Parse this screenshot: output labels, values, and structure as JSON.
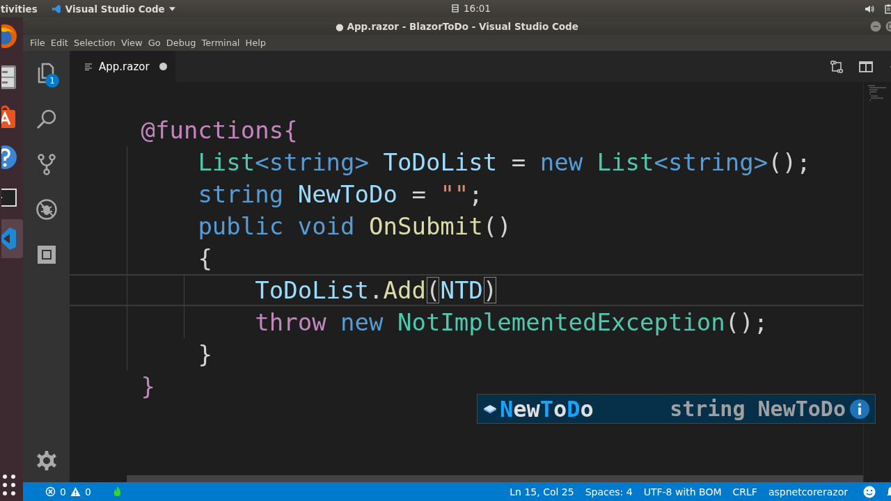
{
  "top_bar": {
    "activities": "tivities",
    "app_menu": "Visual Studio Code",
    "clock": "16:01"
  },
  "dock": [
    {
      "kind": "browser",
      "selected": false
    },
    {
      "kind": "files",
      "selected": false
    },
    {
      "kind": "software",
      "selected": false
    },
    {
      "kind": "help",
      "selected": false
    },
    {
      "kind": "terminal",
      "selected": false
    },
    {
      "kind": "editor",
      "selected": true
    },
    {
      "kind": "apps",
      "selected": false
    }
  ],
  "window": {
    "title": "● App.razor - BlazorToDo - Visual Studio Code"
  },
  "menu": [
    "File",
    "Edit",
    "Selection",
    "View",
    "Go",
    "Debug",
    "Terminal",
    "Help"
  ],
  "activity_bar": {
    "explorer_badge": "1"
  },
  "tabs": [
    {
      "label": "App.razor",
      "selected": true,
      "modified": true
    }
  ],
  "code_lines": [
    {
      "current": false,
      "tokens": [
        {
          "kind": "directive",
          "text": "@functions{"
        }
      ]
    },
    {
      "current": false,
      "tokens": [
        {
          "kind": "type",
          "text": "    List"
        },
        {
          "kind": "keyword",
          "text": "<string>"
        },
        {
          "kind": "variable",
          "text": " ToDoList"
        },
        {
          "kind": "plain",
          "text": " = "
        },
        {
          "kind": "keyword",
          "text": "new"
        },
        {
          "kind": "type",
          "text": " List"
        },
        {
          "kind": "keyword",
          "text": "<string>"
        },
        {
          "kind": "plain",
          "text": "();"
        }
      ]
    },
    {
      "current": false,
      "tokens": [
        {
          "kind": "keyword",
          "text": "    string"
        },
        {
          "kind": "variable",
          "text": " NewToDo"
        },
        {
          "kind": "plain",
          "text": " = "
        },
        {
          "kind": "string",
          "text": "\"\""
        },
        {
          "kind": "plain",
          "text": ";"
        }
      ]
    },
    {
      "current": false,
      "tokens": [
        {
          "kind": "keyword",
          "text": "    public void"
        },
        {
          "kind": "method",
          "text": " OnSubmit"
        },
        {
          "kind": "plain",
          "text": "()"
        }
      ]
    },
    {
      "current": false,
      "tokens": [
        {
          "kind": "plain",
          "text": "    {"
        }
      ]
    },
    {
      "current": true,
      "tokens": [
        {
          "kind": "variable",
          "text": "        ToDoList"
        },
        {
          "kind": "plain",
          "text": "."
        },
        {
          "kind": "method",
          "text": "Add"
        },
        {
          "kind": "bracket-match",
          "text": "("
        },
        {
          "kind": "variable",
          "text": "NTD"
        },
        {
          "kind": "bracket-match",
          "text": ")"
        }
      ]
    },
    {
      "current": false,
      "tokens": [
        {
          "kind": "control",
          "text": "        throw"
        },
        {
          "kind": "keyword",
          "text": " new"
        },
        {
          "kind": "type",
          "text": " NotImplementedException"
        },
        {
          "kind": "plain",
          "text": "();"
        }
      ]
    },
    {
      "current": false,
      "tokens": [
        {
          "kind": "plain",
          "text": "    }"
        }
      ]
    },
    {
      "current": false,
      "tokens": [
        {
          "kind": "directive",
          "text": "}"
        }
      ]
    }
  ],
  "suggestion": {
    "label": [
      {
        "text": "N",
        "match": true
      },
      {
        "text": "ew",
        "match": false
      },
      {
        "text": "T",
        "match": true
      },
      {
        "text": "o",
        "match": false
      },
      {
        "text": "D",
        "match": true
      },
      {
        "text": "o",
        "match": false
      }
    ],
    "detail": "string NewToDo"
  },
  "status_bar": {
    "errors": "0",
    "warnings": "0",
    "items": [
      "Ln 15, Col 25",
      "Spaces: 4",
      "UTF-8 with BOM",
      "CRLF",
      "aspnetcorerazor"
    ]
  }
}
